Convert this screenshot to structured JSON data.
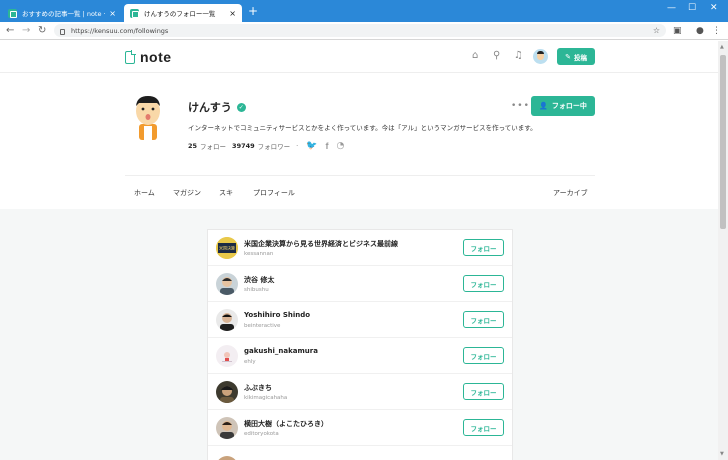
{
  "browser": {
    "tabs": [
      {
        "title": "おすすめの記事一覧 | note ーーつ",
        "active": false
      },
      {
        "title": "けんすうのフォロー一覧",
        "active": true
      }
    ],
    "url": "https://kensuu.com/followings"
  },
  "site": {
    "logo": "note",
    "post_label": "投稿"
  },
  "profile": {
    "name": "けんすう",
    "follow_state_label": "フォロー中",
    "bio": "インターネットでコミュニティサービスとかをよく作っています。今は「アル」というマンガサービスを作っています。",
    "following_count": "25",
    "following_label": "フォロー",
    "followers_count": "39749",
    "followers_label": "フォロワー",
    "separator": "·"
  },
  "profile_tabs": {
    "home": "ホーム",
    "magazine": "マガジン",
    "likes": "スキ",
    "profile": "プロフィール",
    "archive": "アーカイブ"
  },
  "followings": [
    {
      "name": "米国企業決算から見る世界経済とビジネス最前線",
      "id": "kessannan",
      "button": "フォロー",
      "avatar_color": "#e8c84a",
      "avatar_text": "米国決算"
    },
    {
      "name": "渋谷 修太",
      "id": "shibushu",
      "button": "フォロー",
      "avatar_color": "#6b7a82",
      "avatar_text": ""
    },
    {
      "name": "Yoshihiro Shindo",
      "id": "beinteractive",
      "button": "フォロー",
      "avatar_color": "#2c2c2c",
      "avatar_text": ""
    },
    {
      "name": "gakushi_nakamura",
      "id": "ehly",
      "button": "フォロー",
      "avatar_color": "#f3eef2",
      "avatar_text": ""
    },
    {
      "name": "ふぶきち",
      "id": "kikimagicahaha",
      "button": "フォロー",
      "avatar_color": "#3d3a2e",
      "avatar_text": ""
    },
    {
      "name": "横田大樹（よこたひろき）",
      "id": "editoryokota",
      "button": "フォロー",
      "avatar_color": "#8a6d55",
      "avatar_text": ""
    }
  ]
}
